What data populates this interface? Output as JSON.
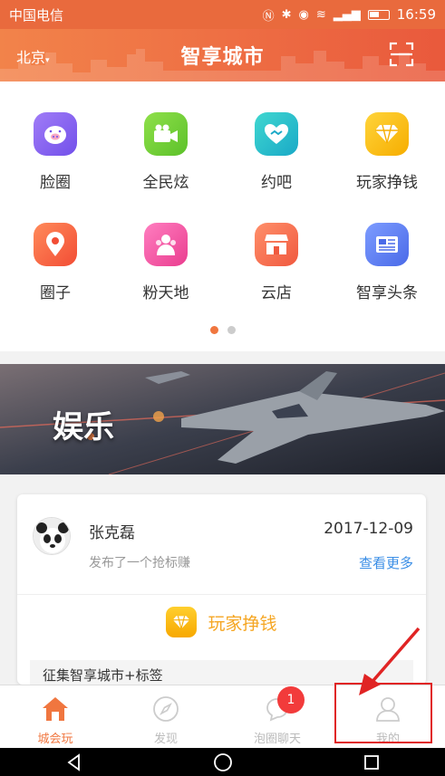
{
  "status_bar": {
    "carrier": "中国电信",
    "time": "16:59"
  },
  "header": {
    "city": "北京",
    "title": "智享城市"
  },
  "grid": [
    {
      "label": "脸圈",
      "icon": "pig-icon",
      "color": "#8a63f2"
    },
    {
      "label": "全民炫",
      "icon": "video-camera-icon",
      "color": "#7bcf3a"
    },
    {
      "label": "约吧",
      "icon": "heart-handshake-icon",
      "color": "#29c4c9"
    },
    {
      "label": "玩家挣钱",
      "icon": "diamond-icon",
      "color": "#ffc21c"
    },
    {
      "label": "圈子",
      "icon": "location-pin-icon",
      "color": "#f4613f"
    },
    {
      "label": "粉天地",
      "icon": "people-icon",
      "color": "#f35ba0"
    },
    {
      "label": "云店",
      "icon": "store-icon",
      "color": "#f46d4d"
    },
    {
      "label": "智享头条",
      "icon": "newspaper-icon",
      "color": "#5a7ef0"
    }
  ],
  "pager": {
    "pages": 2,
    "active": 1
  },
  "banner": {
    "text": "娱乐"
  },
  "card": {
    "name": "张克磊",
    "date": "2017-12-09",
    "desc": "发布了一个抢标赚",
    "more": "查看更多",
    "earn_label": "玩家挣钱",
    "sub_title": "征集智享城市+标签"
  },
  "tabs": [
    {
      "label": "城会玩",
      "icon": "home-icon",
      "active": true
    },
    {
      "label": "发现",
      "icon": "compass-icon",
      "active": false
    },
    {
      "label": "泡圈聊天",
      "icon": "chat-icon",
      "active": false,
      "badge": "1"
    },
    {
      "label": "我的",
      "icon": "person-icon",
      "active": false
    }
  ]
}
